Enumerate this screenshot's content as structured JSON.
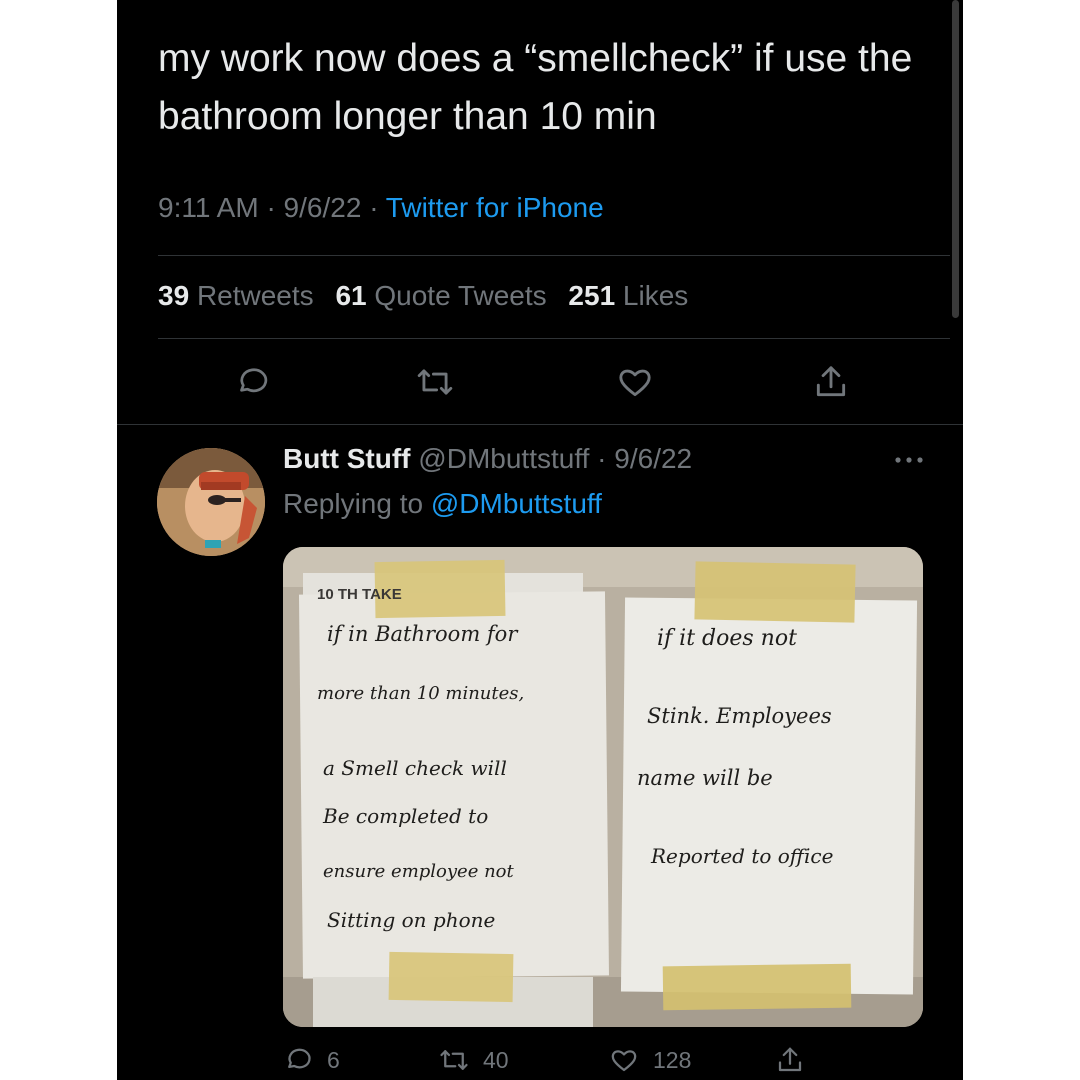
{
  "tweet": {
    "text": "my work now does a “smellcheck” if use the bathroom longer than 10 min",
    "time": "9:11 AM",
    "date": "9/6/22",
    "source": "Twitter for iPhone",
    "retweets_count": "39",
    "retweets_label": "Retweets",
    "quotes_count": "61",
    "quotes_label": "Quote Tweets",
    "likes_count": "251",
    "likes_label": "Likes"
  },
  "reply": {
    "author_name": "Butt Stuff",
    "author_handle": "@DMbuttstuff",
    "date": "9/6/22",
    "replying_label": "Replying to",
    "replying_handle": "@DMbuttstuff",
    "replies_count": "6",
    "retweets_count": "40",
    "likes_count": "128"
  },
  "photo": {
    "left_note_header": "10 TH                TAKE",
    "left_note_lines": [
      "if in Bathroom for",
      "more than 10 minutes,",
      "a Smell check will",
      "Be completed to",
      "ensure employee not",
      "Sitting on phone"
    ],
    "right_note_lines": [
      "if it does not",
      "Stink. Employees",
      "name will be",
      "Reported to office"
    ]
  },
  "colors": {
    "background": "#000000",
    "text_primary": "#e7e9ea",
    "text_secondary": "#71767b",
    "accent": "#1d9bf0",
    "divider": "#2f3336"
  },
  "icons": [
    "reply-icon",
    "retweet-icon",
    "like-icon",
    "share-icon",
    "more-icon"
  ]
}
